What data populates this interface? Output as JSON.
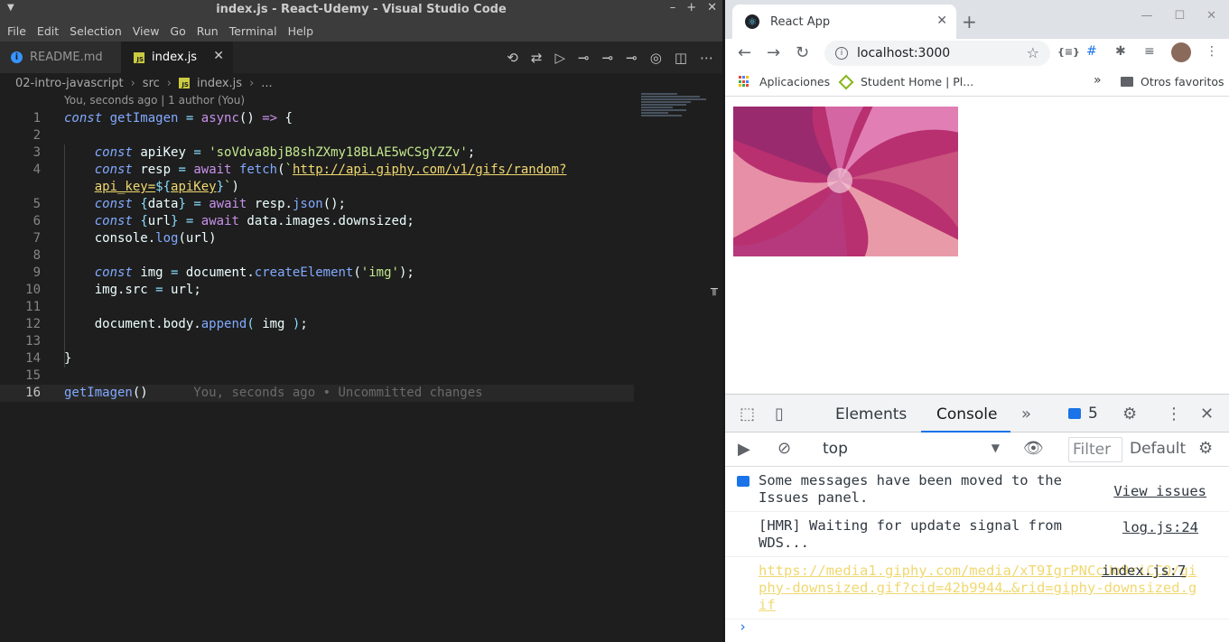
{
  "vscode": {
    "title": "index.js - React-Udemy - Visual Studio Code",
    "menu": [
      "File",
      "Edit",
      "Selection",
      "View",
      "Go",
      "Run",
      "Terminal",
      "Help"
    ],
    "tabs": [
      {
        "label": "README.md",
        "active": false
      },
      {
        "label": "index.js",
        "active": true
      }
    ],
    "breadcrumb": [
      "02-intro-javascript",
      "src",
      "index.js",
      "..."
    ],
    "codelens": "You, seconds ago | 1 author (You)",
    "ghost_blame": "You, seconds ago • Uncommitted changes",
    "lines": [
      "1",
      "2",
      "3",
      "4",
      "5",
      "6",
      "7",
      "8",
      "9",
      "10",
      "11",
      "12",
      "13",
      "14",
      "15",
      "16"
    ],
    "code": {
      "l1": "const getImagen = async() => {",
      "l3_key": "'soVdva8bjB8shZXmy18BLAE5wCSgYZZv'",
      "l4_url1": "http://api.giphy.com/v1/gifs/random?",
      "l4_url2": "api_key=${apiKey}"
    }
  },
  "chrome": {
    "tab_title": "React App",
    "url": "localhost:3000",
    "bookmarks": [
      "Aplicaciones",
      "Student Home | Pl...",
      "Otros favoritos"
    ],
    "devtools": {
      "tabs": [
        "Elements",
        "Console"
      ],
      "active_tab": "Console",
      "issues_count": "5",
      "context": "top",
      "filter_placeholder": "Filter",
      "levels": "Default levels",
      "messages": [
        {
          "text": "Some messages have been moved to the Issues panel.",
          "link": "View issues"
        },
        {
          "text": "[HMR] Waiting for update signal from WDS...",
          "source": "log.js:24"
        },
        {
          "text": "https://media1.giphy.com/media/xT9IgrPNCcUo9riCCQ/giphy-downsized.gif?cid=42b9944…&rid=giphy-downsized.gif",
          "source": "index.js:7"
        }
      ]
    }
  },
  "colors": {
    "vscode_bg": "#1e1e1e",
    "vscode_titlebar": "#3c3c3c",
    "chrome_tabstrip": "#dee1e6",
    "devtools_accent": "#1a73e8"
  }
}
